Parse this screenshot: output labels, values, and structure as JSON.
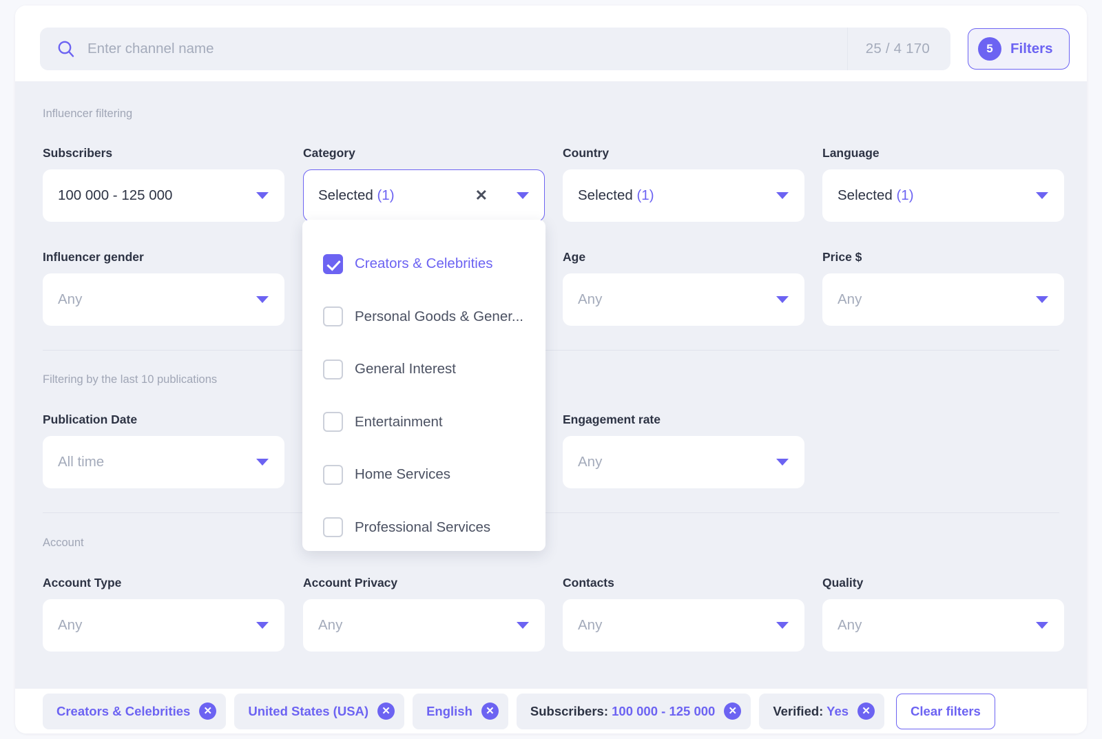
{
  "search": {
    "placeholder": "Enter channel name",
    "value": "",
    "counter": "25 / 4 170",
    "icon": "search-icon"
  },
  "filters_button": {
    "badge": "5",
    "label": "Filters"
  },
  "sections": {
    "influencer": "Influencer filtering",
    "publications": "Filtering by the last 10 publications",
    "account": "Account"
  },
  "fields": {
    "subscribers": {
      "label": "Subscribers",
      "value": "100 000 - 125 000"
    },
    "category": {
      "label": "Category",
      "value": "Selected",
      "count": "(1)"
    },
    "country": {
      "label": "Country",
      "value": "Selected",
      "count": "(1)"
    },
    "language": {
      "label": "Language",
      "value": "Selected",
      "count": "(1)"
    },
    "influencer_gender": {
      "label": "Influencer gender",
      "value": "Any"
    },
    "age": {
      "label": "Age",
      "value": "Any"
    },
    "price": {
      "label": "Price $",
      "value": "Any"
    },
    "publication_date": {
      "label": "Publication Date",
      "value": "All time"
    },
    "engagement_rate": {
      "label": "Engagement rate",
      "value": "Any"
    },
    "account_type": {
      "label": "Account Type",
      "value": "Any"
    },
    "account_privacy": {
      "label": "Account Privacy",
      "value": "Any"
    },
    "contacts": {
      "label": "Contacts",
      "value": "Any"
    },
    "quality": {
      "label": "Quality",
      "value": "Any"
    }
  },
  "category_dropdown": {
    "options": [
      {
        "label": "Creators & Celebrities",
        "checked": true
      },
      {
        "label": "Personal Goods & Gener...",
        "checked": false
      },
      {
        "label": "General Interest",
        "checked": false
      },
      {
        "label": "Entertainment",
        "checked": false
      },
      {
        "label": "Home Services",
        "checked": false
      },
      {
        "label": "Professional Services",
        "checked": false
      }
    ]
  },
  "chips": [
    {
      "prefix": "",
      "value": "Creators & Celebrities"
    },
    {
      "prefix": "",
      "value": "United States (USA)"
    },
    {
      "prefix": "",
      "value": "English"
    },
    {
      "prefix": "Subscribers: ",
      "value": "100 000 - 125 000"
    },
    {
      "prefix": "Verified: ",
      "value": "Yes"
    }
  ],
  "clear_filters_label": "Clear filters",
  "colors": {
    "accent": "#6c63f2",
    "panel_bg": "#eef0f6",
    "card_bg": "#ffffff",
    "text": "#2d3344",
    "muted": "#a4abbb"
  }
}
